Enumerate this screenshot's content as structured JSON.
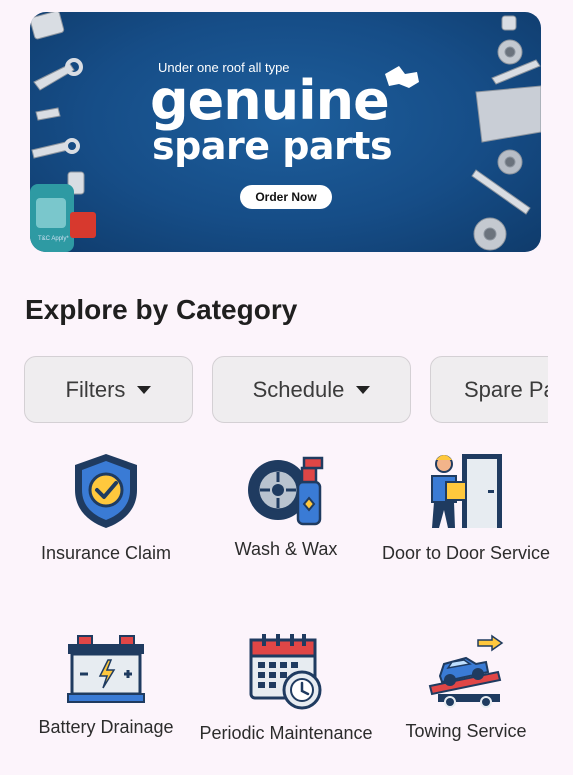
{
  "banner": {
    "tagline": "Under one roof all type",
    "title": "genuine",
    "subtitle": "spare parts",
    "cta": "Order Now",
    "fine_print": "T&C Apply*"
  },
  "section_title": "Explore by Category",
  "chips": [
    {
      "label": "Filters",
      "icon": "caret-down-icon"
    },
    {
      "label": "Schedule",
      "icon": "caret-down-icon"
    },
    {
      "label": "Spare Parts"
    }
  ],
  "categories": [
    {
      "label": "Insurance Claim",
      "icon": "shield-check-icon"
    },
    {
      "label": "Wash & Wax",
      "icon": "tire-spray-icon"
    },
    {
      "label": "Door to Door Service",
      "icon": "delivery-door-icon"
    },
    {
      "label": "Battery Drainage",
      "icon": "battery-icon"
    },
    {
      "label": "Periodic Maintenance",
      "icon": "calendar-clock-icon"
    },
    {
      "label": "Towing Service",
      "icon": "tow-truck-icon"
    }
  ],
  "colors": {
    "background": "#fcf4fb",
    "banner_blue": "#164d87",
    "chip_bg": "#efedef"
  }
}
